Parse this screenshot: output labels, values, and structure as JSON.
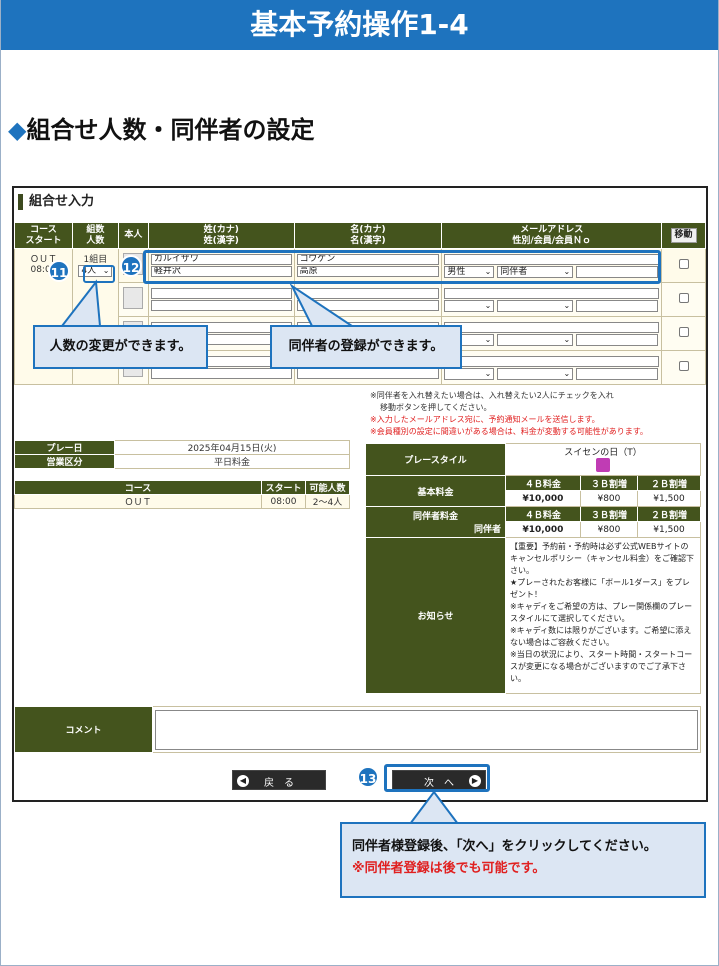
{
  "header": {
    "title": "基本予約操作1-4"
  },
  "section": {
    "title": "組合せ人数・同伴者の設定",
    "marker": "◆"
  },
  "panel": {
    "title": "組合せ入力",
    "columns": {
      "course_start": "コース\nスタート",
      "group_count": "組数\n人数",
      "self": "本人",
      "last_name": "姓(カナ)\n姓(漢字)",
      "first_name": "名(カナ)\n名(漢字)",
      "email": "メールアドレス\n性別/会員/会員Ｎｏ",
      "move": "移動"
    },
    "row1": {
      "course": "ＯＵＴ",
      "start": "08:00",
      "group": "1組目",
      "people": "4人",
      "last_kana": "カルイザワ",
      "last_kanji": "軽井沢",
      "first_kana": "コウゲン",
      "first_kanji": "高原",
      "gender": "男性",
      "member": "同伴者"
    }
  },
  "badges": {
    "b11": "11",
    "b12": "12",
    "b13": "13"
  },
  "callouts": {
    "people": "人数の変更ができます。",
    "companion": "同伴者の登録ができます。",
    "next_line1": "同伴者様登録後、「次へ」をクリックしてください。",
    "next_line2": "※同伴者登録は後でも可能です。"
  },
  "notes": {
    "line1": "※同伴者を入れ替えたい場合は、入れ替えたい2人にチェックを入れ",
    "line2": "移動ボタンを押してください。",
    "line3": "※入力したメールアドレス宛に、予約通知メールを送信します。",
    "line4": "※会員種別の設定に間違いがある場合は、料金が変動する可能性があります。"
  },
  "play_info": {
    "date_label": "プレー日",
    "date_value": "2025年04月15日(火)",
    "business_label": "営業区分",
    "business_value": "平日料金"
  },
  "course_table": {
    "headers": [
      "コース",
      "スタート",
      "可能人数"
    ],
    "row": [
      "ＯＵＴ",
      "08:00",
      "2～4人"
    ]
  },
  "price": {
    "style_label": "プレースタイル",
    "style_value": "スイセンの日（T）",
    "basic_label": "基本料金",
    "companion_label": "同伴者料金",
    "companion_sub": "同伴者",
    "col_headers": [
      "４Ｂ料金",
      "３Ｂ割増",
      "２Ｂ割増"
    ],
    "basic_values": [
      "¥10,000",
      "¥800",
      "¥1,500"
    ],
    "companion_values": [
      "¥10,000",
      "¥800",
      "¥1,500"
    ],
    "notice_label": "お知らせ",
    "notice_text": "【重要】予約前・予約時は必ず公式WEBサイトのキャンセルポリシー（キャンセル料金）をご確認下さい。\n★プレーされたお客様に「ボール1ダース」をプレゼント！\n※キャディをご希望の方は、プレー関係欄のプレースタイルにて選択してください。\n※キャディ数には限りがございます。ご希望に添えない場合はご容赦ください。\n※当日の状況により、スタート時間・スタートコースが変更になる場合がございますのでご了承下さい。"
  },
  "comment": {
    "label": "コメント",
    "value": ""
  },
  "buttons": {
    "back": "戻　る",
    "next": "次　へ"
  },
  "colors": {
    "accent": "#1e73be",
    "table_header": "#44541d",
    "dark_button": "#2a2a2a"
  }
}
